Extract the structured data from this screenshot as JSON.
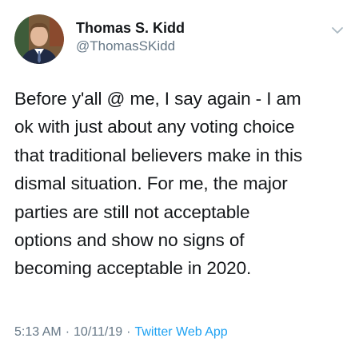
{
  "author": {
    "name": "Thomas S. Kidd",
    "handle": "@ThomasSKidd",
    "avatar_icon": "profile-photo"
  },
  "tweet": {
    "lines": [
      "Before y'all @ me, I say again - I am",
      "ok with just about any voting choice",
      "that traditional believers make in this",
      "dismal situation. For me, the major",
      "parties are still not acceptable",
      "options and show no signs of",
      "becoming acceptable in 2020."
    ]
  },
  "meta": {
    "time": "5:13 AM",
    "separator": "·",
    "date": "10/11/19",
    "source": "Twitter Web App"
  },
  "colors": {
    "text": "#14171a",
    "secondary": "#657786",
    "link": "#1da1f2",
    "background": "#ffffff"
  }
}
